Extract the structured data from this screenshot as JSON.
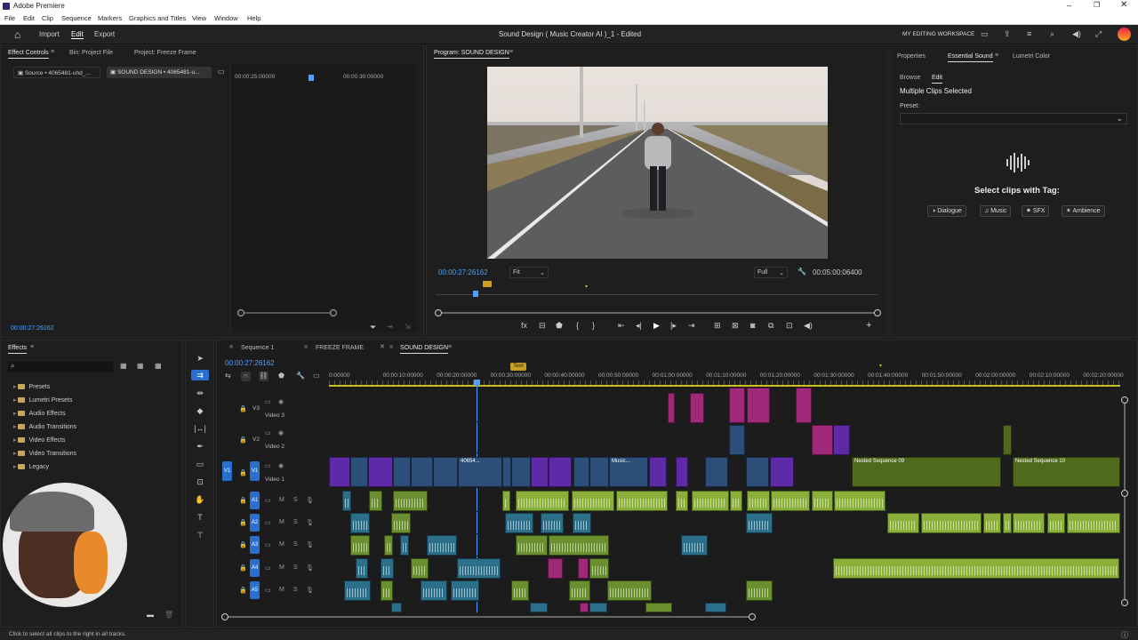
{
  "window": {
    "title": "Adobe Premiere"
  },
  "menu": [
    "File",
    "Edit",
    "Clip",
    "Sequence",
    "Markers",
    "Graphics and Titles",
    "View",
    "Window",
    "Help"
  ],
  "appbar": {
    "tabs": [
      "Import",
      "Edit",
      "Export"
    ],
    "project_title": "Sound Design ( Music Creator AI )_1 - Edited",
    "workspace": "MY EDITING WORKSPACE"
  },
  "effect_controls": {
    "tabs": [
      "Effect Controls",
      "Bin: Project File",
      "Project: Freeze Frame"
    ],
    "source_tab": "Source • 4065481-uhd_...",
    "sequence_tab": "SOUND DESIGN • 4065481-u...",
    "time_a": "00:00:25:00000",
    "time_b": "00:00:30:00000",
    "timecode": "00:00:27:26162"
  },
  "program": {
    "title": "Program: SOUND DESIGN",
    "timecode": "00:00:27:26162",
    "fit": "Fit",
    "quality": "Full",
    "duration": "00:05:00:06400"
  },
  "essential_sound": {
    "tabs": [
      "Properties",
      "Essential Sound",
      "Lumetri Color"
    ],
    "subtabs": [
      "Browse",
      "Edit"
    ],
    "heading": "Multiple Clips Selected",
    "preset_label": "Preset:",
    "select_heading": "Select clips with Tag:",
    "tags": [
      "Dialogue",
      "Music",
      "SFX",
      "Ambience"
    ]
  },
  "effects": {
    "title": "Effects",
    "items": [
      "Presets",
      "Lumetri Presets",
      "Audio Effects",
      "Audio Transitions",
      "Video Effects",
      "Video Transitions",
      "Legacy"
    ]
  },
  "timeline": {
    "tabs": [
      "Sequence 1",
      "FREEZE FRAME",
      "SOUND DESIGN"
    ],
    "timecode": "00:00:27:26162",
    "marker_label": "Text",
    "ruler": [
      "0:00000",
      "00:00:10:00000",
      "00:00:20:00000",
      "00:00:30:00000",
      "00:00:40:00000",
      "00:00:50:00000",
      "00:01:00:00000",
      "00:01:10:00000",
      "00:01:20:00000",
      "00:01:30:00000",
      "00:01:40:00000",
      "00:01:50:00000",
      "00:02:00:00000",
      "00:02:10:00000",
      "00:02:20:00000"
    ],
    "video_tracks": [
      {
        "id": "V3",
        "name": "Video 3"
      },
      {
        "id": "V2",
        "name": "Video 2"
      },
      {
        "id": "V1",
        "name": "Video 1"
      }
    ],
    "audio_tracks": [
      "A1",
      "A2",
      "A3",
      "A4",
      "A5"
    ],
    "clip_labels": {
      "c1": "40654...",
      "c2": "Music...",
      "n1": "Nested Sequence 09",
      "n2": "Nested Sequence 10"
    }
  },
  "status": "Click to select all clips to the right in all tracks.",
  "icons": [
    "home-icon",
    "play-icon",
    "wrench-icon",
    "search-icon",
    "folder-icon",
    "eye-icon",
    "lock-icon",
    "mic-icon"
  ]
}
